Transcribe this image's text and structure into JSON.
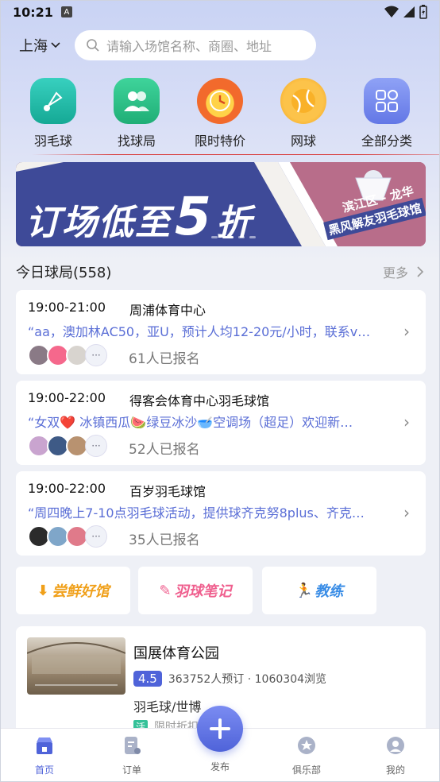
{
  "status_bar": {
    "time": "10:21",
    "notif_badge": "A"
  },
  "header": {
    "city": "上海",
    "search_placeholder": "请输入场馆名称、商圈、地址"
  },
  "categories": [
    {
      "label": "羽毛球",
      "icon": "badminton-icon",
      "color": "#1fb8a7"
    },
    {
      "label": "找球局",
      "icon": "people-icon",
      "color": "#2bbf86"
    },
    {
      "label": "限时特价",
      "icon": "clock-icon",
      "color": "#f27a2a"
    },
    {
      "label": "网球",
      "icon": "tennis-icon",
      "color": "#f6a21a"
    },
    {
      "label": "全部分类",
      "icon": "grid-icon",
      "color": "#6f86ef"
    }
  ],
  "banner": {
    "headline": "订场低至",
    "big_number": "5",
    "suffix": "折",
    "district": "滨江区 - 龙华",
    "venue": "黑风解友羽毛球馆"
  },
  "today_games": {
    "title": "今日球局(558)",
    "more_label": "更多",
    "items": [
      {
        "time": "19:00-21:00",
        "venue": "周浦体育中心",
        "desc": "“aa，澳加林AC50，亚U，预计人均12-20元/小时，联系v…",
        "signed": "61人已报名"
      },
      {
        "time": "19:00-22:00",
        "venue": "得客会体育中心羽毛球馆",
        "desc": "“女双❤️ 冰镇西瓜🍉绿豆冰沙🥣空调场（超足）欢迎新…",
        "signed": "52人已报名"
      },
      {
        "time": "19:00-22:00",
        "venue": "百岁羽毛球馆",
        "desc": "“周四晚上7-10点羽毛球活动，提供球齐克努8plus、齐克…",
        "signed": "35人已报名"
      }
    ]
  },
  "feature_tiles": [
    {
      "label": "尝鲜好馆",
      "color": "#f0a01a"
    },
    {
      "label": "羽球笔记",
      "color": "#ef5f8e"
    },
    {
      "label": "教练",
      "color": "#3a8de6"
    }
  ],
  "venue_card": {
    "name": "国展体育公园",
    "score": "4.5",
    "stats": "363752人预订 · 1060304浏览",
    "sport": "羽毛球/世博",
    "promo_tag": "活",
    "promo_text": "限时折扣"
  },
  "tabbar": {
    "items": [
      {
        "label": "首页",
        "active": true
      },
      {
        "label": "订单",
        "active": false
      },
      {
        "label": "发布",
        "active": false
      },
      {
        "label": "俱乐部",
        "active": false
      },
      {
        "label": "我的",
        "active": false
      }
    ]
  },
  "colors": {
    "accent": "#4f63d9",
    "link_text": "#5a6ed6"
  }
}
